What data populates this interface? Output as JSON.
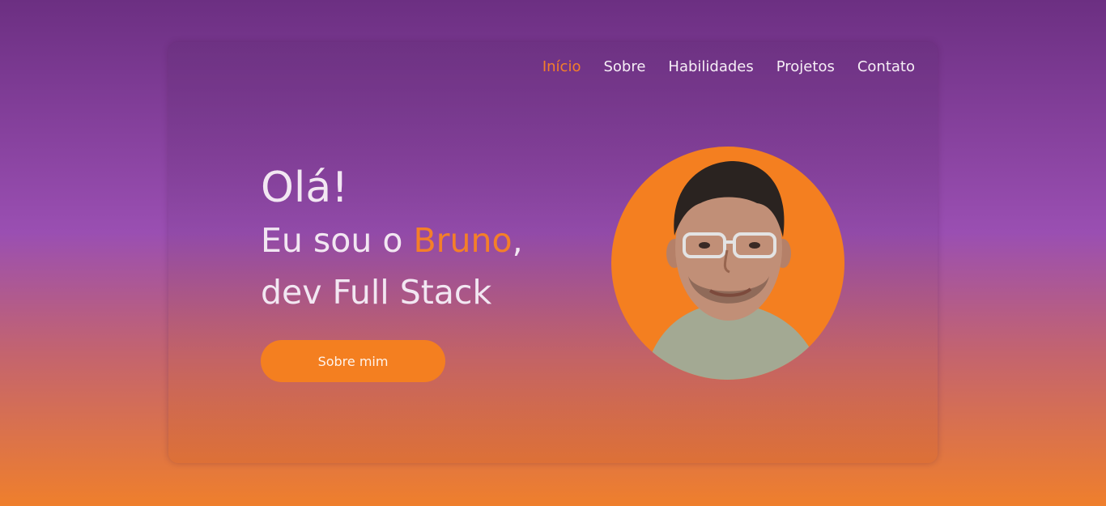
{
  "nav": {
    "items": [
      {
        "label": "Início",
        "active": true
      },
      {
        "label": "Sobre",
        "active": false
      },
      {
        "label": "Habilidades",
        "active": false
      },
      {
        "label": "Projetos",
        "active": false
      },
      {
        "label": "Contato",
        "active": false
      }
    ]
  },
  "hero": {
    "greeting": "Olá!",
    "intro_prefix": "Eu sou o ",
    "name": "Bruno",
    "intro_suffix": ",",
    "role": "dev Full Stack",
    "button_label": "Sobre mim"
  },
  "colors": {
    "accent": "#f47f20",
    "background_top": "#6c2f82",
    "background_bottom": "#ef7f2c"
  },
  "avatar": {
    "icon": "person-photo"
  }
}
